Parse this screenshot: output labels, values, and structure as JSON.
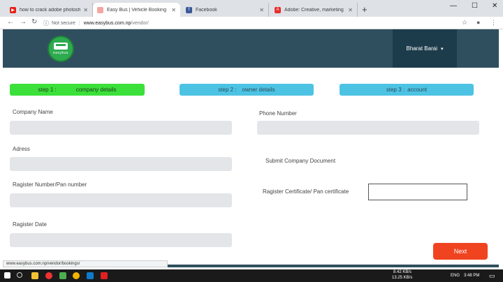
{
  "browser": {
    "tabs": [
      {
        "label": "how to crack adobe photoshop c",
        "icon": "youtube-icon",
        "color": "#e62117"
      },
      {
        "label": "Easy Bus | Vehicle Booking",
        "icon": "easybus-favicon",
        "color": "#f4a6a0"
      },
      {
        "label": "Facebook",
        "icon": "facebook-icon",
        "color": "#3b5998"
      },
      {
        "label": "Adobe: Creative, marketing and",
        "icon": "adobe-icon",
        "color": "#e82b2b"
      }
    ],
    "new_tab": "+",
    "address": {
      "security": "Not secure",
      "host": "www.easybus.com.np",
      "path": "/vendor/"
    }
  },
  "site": {
    "logo_text": "easybus",
    "user_name": "Bharat Barai",
    "user_chevron": "▾"
  },
  "steps": [
    {
      "number": "step 1 :",
      "name": "company details",
      "color": "#3ce03a"
    },
    {
      "number": "step 2 :",
      "name": "owner details",
      "color": "#4dc3e4"
    },
    {
      "number": "step  3  :",
      "name": "account",
      "color": "#4dc3e4"
    }
  ],
  "form": {
    "company_name": "Company Name",
    "address": "Adress",
    "register_number": "Ragister Number/Pan number",
    "register_date": "Ragister Date",
    "phone": "Phone Number",
    "submit_docs": "Submit  Company  Document",
    "certificate": "Ragister Certificate/ Pan certificate",
    "next": "Next"
  },
  "status_url": "www.easybus.com.np/vendor/bookings/",
  "taskbar": {
    "net_up": "8.42 KB/s",
    "net_down": "13.25 KB/s",
    "lang": "ENG",
    "time": "3:48 PM"
  }
}
